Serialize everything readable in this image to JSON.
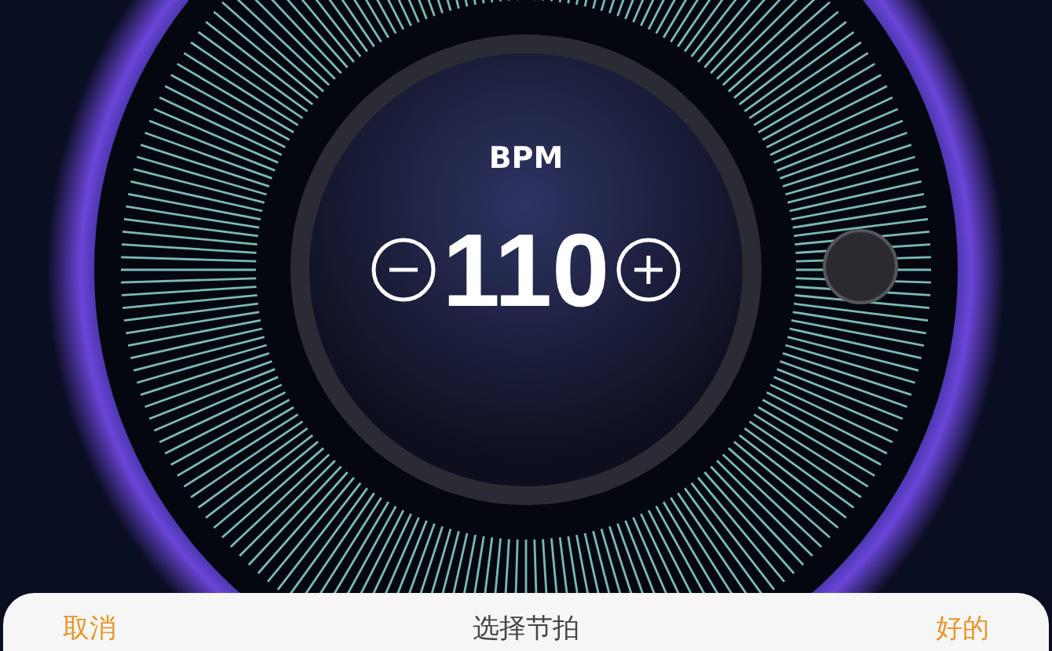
{
  "dial": {
    "label": "BPM",
    "value": "110"
  },
  "sheet": {
    "cancel": "取消",
    "title": "选择节拍",
    "confirm": "好的"
  }
}
